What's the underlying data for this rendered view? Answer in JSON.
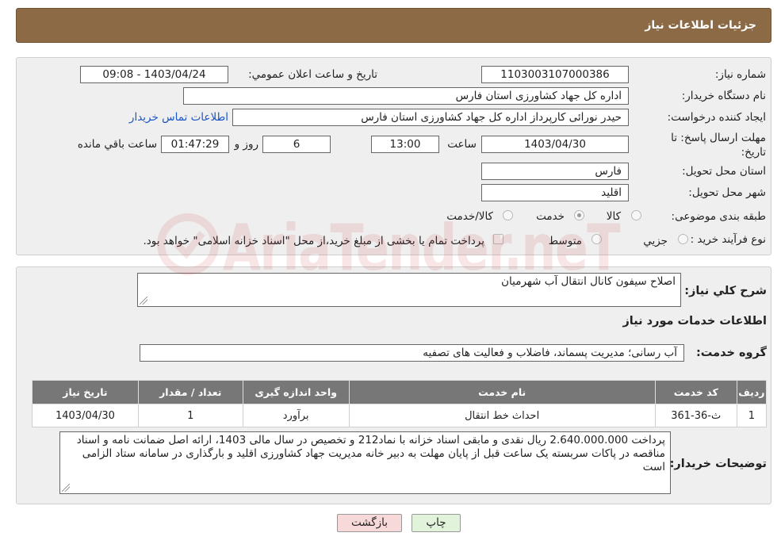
{
  "header": {
    "title": "جزئیات اطلاعات نیاز"
  },
  "form": {
    "need_number": {
      "label": "شماره نیاز:",
      "value": "1103003107000386"
    },
    "announce_datetime": {
      "label": "تاریخ و ساعت اعلان عمومي:",
      "value": "1403/04/24 - 09:08"
    },
    "buyer_org": {
      "label": "نام دستگاه خريدار:",
      "value": "اداره کل جهاد کشاورزی استان فارس"
    },
    "requester": {
      "label": "ايجاد کننده درخواست:",
      "value": "حیدر نورائی کارپرداز اداره کل جهاد کشاورزی استان فارس",
      "contact_link": "اطلاعات تماس خريدار"
    },
    "deadline": {
      "label": "مهلت ارسال پاسخ: تا تاریخ:",
      "date": "1403/04/30",
      "time_label": "ساعت",
      "time": "13:00",
      "days": "6",
      "days_label": "روز و",
      "remaining": "01:47:29",
      "remaining_label": "ساعت باقي مانده"
    },
    "delivery_province": {
      "label": "استان محل تحويل:",
      "value": "فارس"
    },
    "delivery_city": {
      "label": "شهر محل تحويل:",
      "value": "اقليد"
    },
    "category": {
      "label": "طبقه بندی موضوعی:",
      "options": [
        "کالا",
        "خدمت",
        "کالا/خدمت"
      ],
      "selected": "خدمت"
    },
    "purchase_process": {
      "label": "نوع فرآيند خريد :",
      "options": [
        "جزيي",
        "متوسط"
      ],
      "checkbox_text": "پرداخت تمام يا بخشی از مبلغ خريد،از محل \"اسناد خزانه اسلامی\" خواهد بود."
    }
  },
  "summary": {
    "label": "شرح کلي نياز:",
    "value": "اصلاح سیفون کانال انتقال آب  شهرمیان"
  },
  "services_section": {
    "title": "اطلاعات خدمات مورد نياز",
    "group_label": "گروه خدمت:",
    "group_value": "آب رسانی؛ مدیریت پسماند، فاضلاب و فعالیت های تصفیه"
  },
  "table": {
    "headers": [
      "رديف",
      "کد خدمت",
      "نام خدمت",
      "واحد اندازه گيری",
      "تعداد / مقدار",
      "تاريخ نياز"
    ],
    "rows": [
      [
        "1",
        "ث-36-361",
        "احداث خط انتقال",
        "برآورد",
        "1",
        "1403/04/30"
      ]
    ]
  },
  "buyer_notes": {
    "label": "توضيحات خريدار:",
    "text": "پرداخت 2.640.000.000 ریال نقدی و مابقی اسناد خزانه با نماد212 و تخصیص در سال مالی 1403، ارائه اصل ضمانت نامه و اسناد مناقصه  در پاکات سربسته یک ساعت قبل از پایان مهلت به دبیر خانه مدیریت جهاد کشاورزی اقلید  و بارگذاری در سامانه ستاد الزامی است"
  },
  "buttons": {
    "print": "چاپ",
    "back": "بازگشت"
  },
  "colors": {
    "header": "#8b6a45",
    "table_header": "#777777",
    "link": "#1a55c8",
    "back_button": "#f8d9d9",
    "print_button": "#e2f3dc"
  },
  "watermark": "AriaTender.neT"
}
